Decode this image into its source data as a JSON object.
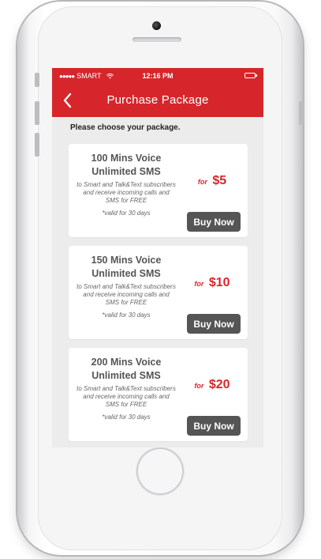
{
  "status_bar": {
    "signal": "●●●●●",
    "carrier": "SMART",
    "time": "12:16 PM"
  },
  "nav": {
    "back_icon": "chevron-left-icon",
    "title": "Purchase Package"
  },
  "prompt": "Please choose your package.",
  "packages": [
    {
      "title_line1": "100 Mins Voice",
      "title_line2": "Unlimited SMS",
      "description": "to Smart and Talk&Text subscribers and receive incoming calls and SMS for FREE",
      "validity": "*valid for 30 days",
      "price_prefix": "for",
      "price": "$5",
      "button_label": "Buy Now"
    },
    {
      "title_line1": "150 Mins Voice",
      "title_line2": "Unlimited SMS",
      "description": "to Smart and Talk&Text subscribers and receive incoming calls and SMS for FREE",
      "validity": "*valid for 30 days",
      "price_prefix": "for",
      "price": "$10",
      "button_label": "Buy Now"
    },
    {
      "title_line1": "200 Mins Voice",
      "title_line2": "Unlimited SMS",
      "description": "to Smart and Talk&Text subscribers and receive incoming calls and SMS for FREE",
      "validity": "*valid for 30 days",
      "price_prefix": "for",
      "price": "$20",
      "button_label": "Buy Now"
    }
  ],
  "colors": {
    "brand_red": "#d6262b",
    "button_gray": "#555555",
    "screen_bg": "#ececec"
  }
}
